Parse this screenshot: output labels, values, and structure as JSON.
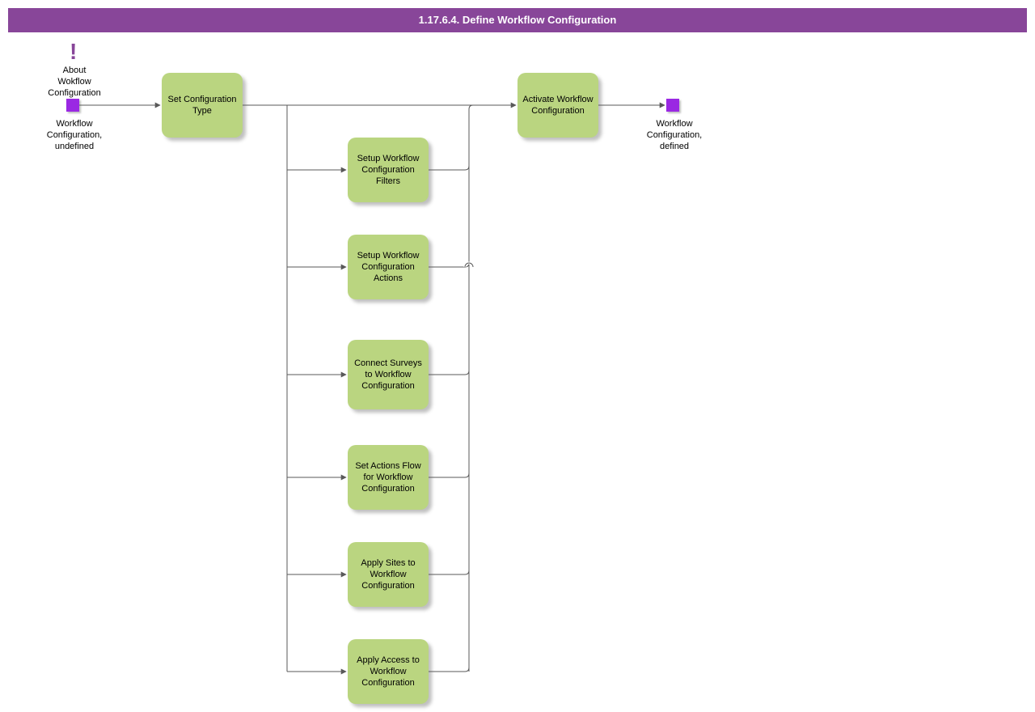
{
  "title": "1.17.6.4. Define Workflow Configuration",
  "about_label": "About\nWokflow\nConfiguration",
  "start_state_label": "Workflow\nConfiguration,\nundefined",
  "end_state_label": "Workflow\nConfiguration,\ndefined",
  "activities": {
    "set_config_type": "Set\nConfiguration\nType",
    "setup_filters": "Setup Workflow\nConfiguration\nFilters",
    "setup_actions": "Setup Workflow\nConfiguration\nActions",
    "connect_surveys": "Connect\nSurveys to\nWorkflow\nConfiguration",
    "set_actions_flow": "Set Actions Flow\nfor Workflow\nConfiguration",
    "apply_sites": "Apply Sites to\nWorkflow\nConfiguration",
    "apply_access": "Apply Access to\nWorkflow\nConfiguration",
    "activate": "Activate\nWorkflow\nConfiguration"
  },
  "colors": {
    "header_purple": "#884699",
    "state_purple": "#9a28e3",
    "activity_green": "#bad580",
    "edge_gray": "#595959"
  }
}
